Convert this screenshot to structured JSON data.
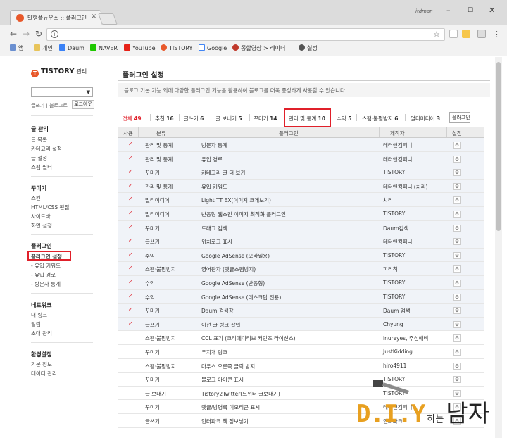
{
  "browser": {
    "tab_title": "발행플뉴우스 :: 플러그인 설정",
    "user_name": "itdman",
    "bookmarks": [
      {
        "label": "앱",
        "icon": "apps-icon"
      },
      {
        "label": "개인",
        "icon": "folder-icon"
      },
      {
        "label": "Daum",
        "icon": "daum-icon"
      },
      {
        "label": "NAVER",
        "icon": "naver-icon"
      },
      {
        "label": "YouTube",
        "icon": "youtube-icon"
      },
      {
        "label": "TISTORY",
        "icon": "tistory-icon"
      },
      {
        "label": "Google",
        "icon": "google-icon"
      },
      {
        "label": "종합영상 > 레이더",
        "icon": "radar-icon"
      },
      {
        "label": "설정",
        "icon": "gear-icon"
      }
    ]
  },
  "sidebar": {
    "logo": "TISTORY",
    "logo_sub": "관리",
    "blog_links": "글쓰기 | 블로그로",
    "logout": "로그아웃",
    "sections": [
      {
        "heading": "글 관리",
        "items": [
          "글 목록",
          "카테고리 설정",
          "글 설정",
          "스팸 필터"
        ]
      },
      {
        "heading": "꾸미기",
        "items": [
          "스킨",
          "HTML/CSS 편집",
          "사이드바",
          "화면 설정"
        ]
      },
      {
        "heading": "플러그인",
        "items": [
          "플러그인 설정",
          "- 유입 키워드",
          "- 유입 경로",
          "- 방문자 통계"
        ]
      },
      {
        "heading": "네트워크",
        "items": [
          "내 링크",
          "알림",
          "초대 관리"
        ]
      },
      {
        "heading": "환경설정",
        "items": [
          "기본 정보",
          "데이터 관리"
        ]
      }
    ]
  },
  "main": {
    "title": "플러그인 설정",
    "description": "블로그 기본 기능 외에 다양한 플러그인 기능을 활용하여 블로그를 더욱 풍성하게 사용할 수 있습니다.",
    "filters": [
      {
        "label": "전체",
        "count": "49"
      },
      {
        "label": "추천",
        "count": "16"
      },
      {
        "label": "글쓰기",
        "count": "6"
      },
      {
        "label": "글 보내기",
        "count": "5"
      },
      {
        "label": "꾸미기",
        "count": "14"
      },
      {
        "label": "관리 및 통계",
        "count": "10"
      },
      {
        "label": "수익",
        "count": "5"
      },
      {
        "label": "스팸·불펌방지",
        "count": "6"
      },
      {
        "label": "멀티미디어",
        "count": "3"
      }
    ],
    "more_button": "플러그인",
    "columns": {
      "use": "사용",
      "category": "분류",
      "plugin": "플러그인",
      "author": "제작자",
      "settings": "설정"
    },
    "rows": [
      {
        "on": true,
        "category": "관리 및 통계",
        "plugin": "방문자 통계",
        "author": "테터앤컴퍼니"
      },
      {
        "on": true,
        "category": "관리 및 통계",
        "plugin": "유입 경로",
        "author": "테터앤컴퍼니"
      },
      {
        "on": true,
        "category": "꾸미기",
        "plugin": "카테고리 글 더 보기",
        "author": "TISTORY"
      },
      {
        "on": true,
        "category": "관리 및 통계",
        "plugin": "유입 키워드",
        "author": "테터앤컴퍼니 (치리)"
      },
      {
        "on": true,
        "category": "멀티미디어",
        "plugin": "Light TT EX(이미지 크게보기)",
        "author": "치리"
      },
      {
        "on": true,
        "category": "멀티미디어",
        "plugin": "반응형 웹스킨 이미지 최적화 플러그인",
        "author": "TISTORY"
      },
      {
        "on": true,
        "category": "꾸미기",
        "plugin": "드래그 검색",
        "author": "Daum검색"
      },
      {
        "on": true,
        "category": "글쓰기",
        "plugin": "위치로그 표시",
        "author": "테터앤컴퍼니"
      },
      {
        "on": true,
        "category": "수익",
        "plugin": "Google AdSense (모바일용)",
        "author": "TISTORY"
      },
      {
        "on": true,
        "category": "스팸·불펌방지",
        "plugin": "영어완자 (댓글스팸방지)",
        "author": "피리칙"
      },
      {
        "on": true,
        "category": "수익",
        "plugin": "Google AdSense (반응형)",
        "author": "TISTORY"
      },
      {
        "on": true,
        "category": "수익",
        "plugin": "Google AdSense (데스크탑 전용)",
        "author": "TISTORY"
      },
      {
        "on": true,
        "category": "꾸미기",
        "plugin": "Daum 검색창",
        "author": "Daum 검색"
      },
      {
        "on": true,
        "category": "글쓰기",
        "plugin": "이전 글 링크 삽입",
        "author": "Chyung"
      },
      {
        "on": false,
        "category": "스팸·불펌방지",
        "plugin": "CCL 표기 (크리에이티브 커먼즈 라이선스)",
        "author": "inureyes, 주성애비"
      },
      {
        "on": false,
        "category": "꾸미기",
        "plugin": "우지개 링크",
        "author": "JustKidding"
      },
      {
        "on": false,
        "category": "스팸·불펌방지",
        "plugin": "마우스 오른쪽 클릭 방지",
        "author": "hiro4911"
      },
      {
        "on": false,
        "category": "꾸미기",
        "plugin": "블로그 아이콘 표시",
        "author": "TISTORY"
      },
      {
        "on": false,
        "category": "글 보내기",
        "plugin": "Tistory2Twitter(트위터 글보내기)",
        "author": "TISTORY"
      },
      {
        "on": false,
        "category": "꾸미기",
        "plugin": "댓글/방명록 이모티콘 표시",
        "author": "테터앤컴퍼니"
      },
      {
        "on": false,
        "category": "글쓰기",
        "plugin": "인터파크 책 정보넣기",
        "author": "인터파크"
      }
    ]
  },
  "watermark": {
    "diy": "D.I.Y",
    "mid": "하는",
    "end": "남자"
  },
  "colors": {
    "highlight": "#e0202a",
    "tistory": "#e8582a",
    "diy": "#e8a020"
  }
}
